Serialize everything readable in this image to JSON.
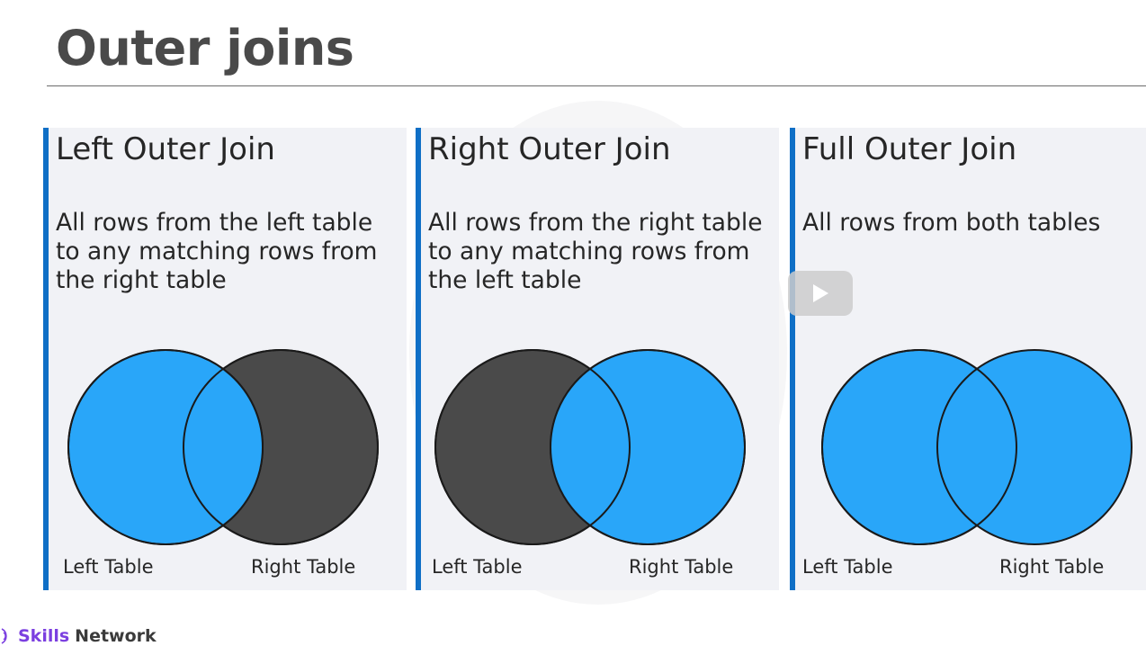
{
  "slide": {
    "title": "Outer joins",
    "cards": [
      {
        "title": "Left Outer Join",
        "description": "All rows from the left table to any matching rows from the right table",
        "left_label": "Left Table",
        "right_label": "Right Table",
        "left_fill": "#29a6f9",
        "right_fill": "#4a4a4a"
      },
      {
        "title": "Right Outer Join",
        "description": "All rows from the right table to any matching rows from the left table",
        "left_label": "Left Table",
        "right_label": "Right Table",
        "left_fill": "#4a4a4a",
        "right_fill": "#29a6f9"
      },
      {
        "title": "Full Outer Join",
        "description": "All rows from both tables",
        "left_label": "Left Table",
        "right_label": "Right Table",
        "left_fill": "#29a6f9",
        "right_fill": "#29a6f9"
      }
    ]
  },
  "brand": {
    "name_primary": "Skills",
    "name_secondary": "Network"
  },
  "colors": {
    "accent_bar": "#0f6fc6",
    "highlight_blue": "#29a6f9",
    "dark_gray": "#4a4a4a",
    "card_background": "#f1f2f6"
  },
  "overlay": {
    "icon": "play-icon"
  }
}
